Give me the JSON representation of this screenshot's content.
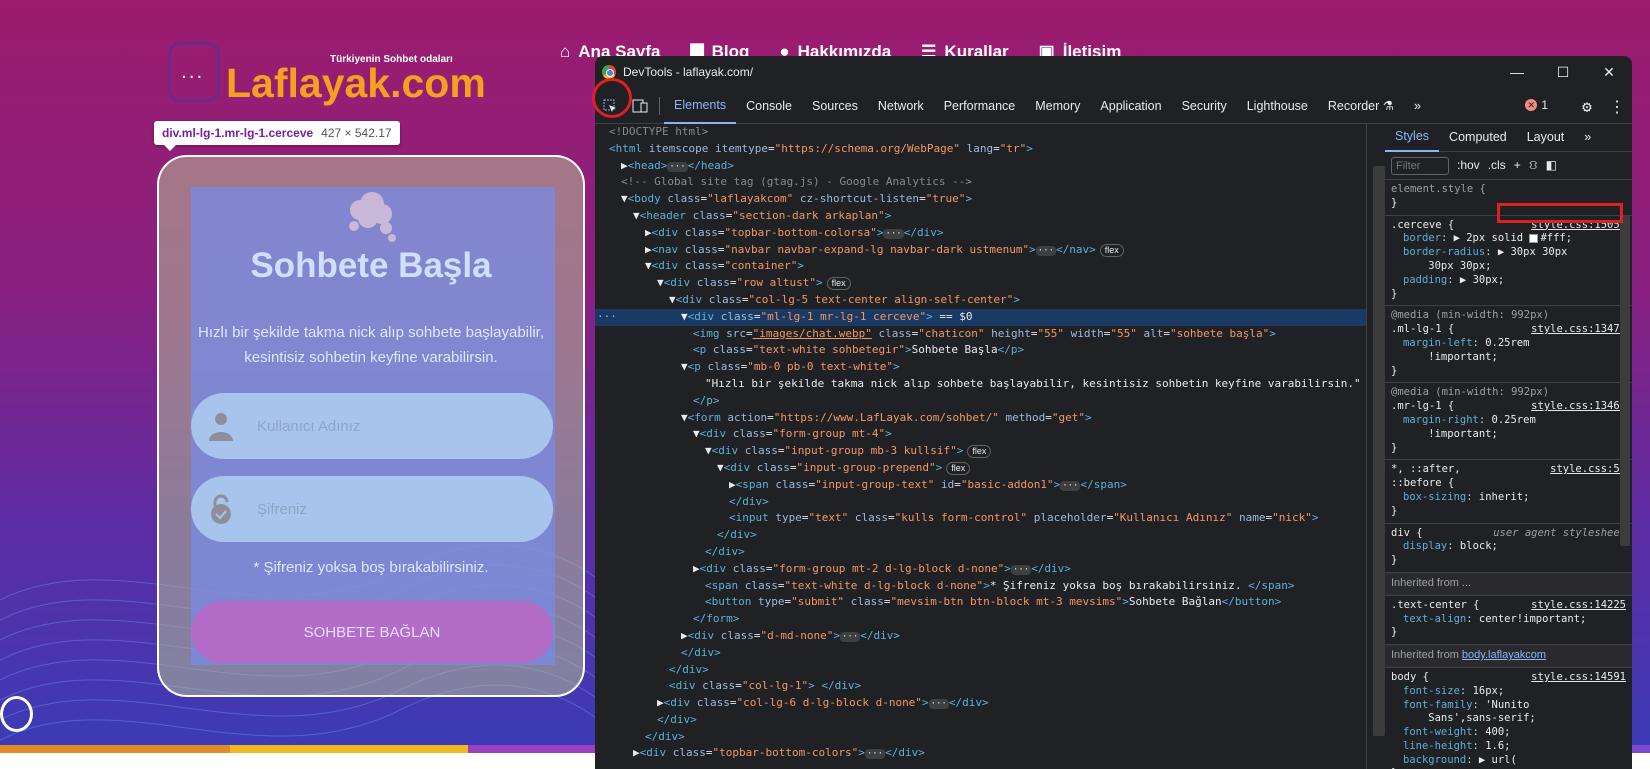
{
  "site": {
    "tagline": "Türkiyenin Sohbet odaları",
    "logo_text": "Laflayak.com",
    "nav": [
      "Ana Sayfa",
      "Blog",
      "Hakkımızda",
      "Kurallar",
      "İletişim"
    ],
    "card": {
      "title": "Sohbete Başla",
      "desc": "Hızlı bir şekilde takma nick alıp sohbete başlayabilir, kesintisiz sohbetin keyfine varabilirsin.",
      "username_placeholder": "Kullanıcı Adınız",
      "password_placeholder": "Şifreniz",
      "note": "* Şifreniz yoksa boş bırakabilirsiniz.",
      "button": "SOHBETE BAĞLAN"
    },
    "tooltip": {
      "selector": "div.ml-lg-1.mr-lg-1.cerceve",
      "size": "427 × 542.17"
    },
    "strip_colors": [
      "#e08a2a",
      "#f5b820",
      "#9c3fc0",
      "#7a4ad0"
    ]
  },
  "devtools": {
    "title": "DevTools - laflayak.com/",
    "tabs": [
      "Elements",
      "Console",
      "Sources",
      "Network",
      "Performance",
      "Memory",
      "Application",
      "Security",
      "Lighthouse",
      "Recorder"
    ],
    "active_tab": "Elements",
    "error_count": "1",
    "dom_lines": [
      {
        "i": 0,
        "h": "<span class='cmt'>&lt;!DOCTYPE html&gt;</span>"
      },
      {
        "i": 0,
        "h": "<span class='tag'>&lt;html</span> <span class='attr'>itemscope itemtype</span>=<span class='val'>\"https://schema.org/WebPage\"</span> <span class='attr'>lang</span>=<span class='val'>\"tr\"</span><span class='tag'>&gt;</span>"
      },
      {
        "i": 1,
        "h": "▶<span class='tag'>&lt;head&gt;</span><span class='dots'>···</span><span class='tag'>&lt;/head&gt;</span>"
      },
      {
        "i": 1,
        "h": "<span class='cmt'>&lt;!-- Global site tag (gtag.js) - Google Analytics --&gt;</span>"
      },
      {
        "i": 1,
        "h": "▼<span class='tag'>&lt;body</span> <span class='attr'>class</span>=<span class='val'>\"laflayakcom\"</span> <span class='attr'>cz-shortcut-listen</span>=<span class='val'>\"true\"</span><span class='tag'>&gt;</span>"
      },
      {
        "i": 2,
        "h": "▼<span class='tag'>&lt;header</span> <span class='attr'>class</span>=<span class='val'>\"section-dark arkaplan\"</span><span class='tag'>&gt;</span>"
      },
      {
        "i": 3,
        "h": "▶<span class='tag'>&lt;div</span> <span class='attr'>class</span>=<span class='val'>\"topbar-bottom-colorsa\"</span><span class='tag'>&gt;</span><span class='dots'>···</span><span class='tag'>&lt;/div&gt;</span>"
      },
      {
        "i": 3,
        "h": "▶<span class='tag'>&lt;nav</span> <span class='attr'>class</span>=<span class='val'>\"navbar navbar-expand-lg navbar-dark ustmenum\"</span><span class='tag'>&gt;</span><span class='dots'>···</span><span class='tag'>&lt;/nav&gt;</span><span class='flexb'>flex</span>"
      },
      {
        "i": 3,
        "h": "▼<span class='tag'>&lt;div</span> <span class='attr'>class</span>=<span class='val'>\"container\"</span><span class='tag'>&gt;</span>"
      },
      {
        "i": 4,
        "h": "▼<span class='tag'>&lt;div</span> <span class='attr'>class</span>=<span class='val'>\"row altust\"</span><span class='tag'>&gt;</span><span class='flexb'>flex</span>"
      },
      {
        "i": 5,
        "h": "▼<span class='tag'>&lt;div</span> <span class='attr'>class</span>=<span class='val'>\"col-lg-5 text-center align-self-center\"</span><span class='tag'>&gt;</span>"
      },
      {
        "i": 6,
        "h": "▼<span class='tag'>&lt;div</span> <span class='attr'>class</span>=<span class='val'>\"ml-lg-1 mr-lg-1 cerceve\"</span><span class='tag'>&gt;</span> == $0",
        "sel": true
      },
      {
        "i": 7,
        "h": "<span class='tag'>&lt;img</span> <span class='attr'>src</span>=<span class='link'>\"images/chat.webp\"</span> <span class='attr'>class</span>=<span class='val'>\"chaticon\"</span> <span class='attr'>height</span>=<span class='val'>\"55\"</span> <span class='attr'>width</span>=<span class='val'>\"55\"</span> <span class='attr'>alt</span>=<span class='val'>\"sohbete başla\"</span><span class='tag'>&gt;</span>"
      },
      {
        "i": 7,
        "h": "<span class='tag'>&lt;p</span> <span class='attr'>class</span>=<span class='val'>\"text-white sohbetegir\"</span><span class='tag'>&gt;</span>Sohbete Başla<span class='tag'>&lt;/p&gt;</span>"
      },
      {
        "i": 6,
        "h": "▼<span class='tag'>&lt;p</span> <span class='attr'>class</span>=<span class='val'>\"mb-0 pb-0 text-white\"</span><span class='tag'>&gt;</span>"
      },
      {
        "i": 8,
        "h": "\"Hızlı bir şekilde takma nick alıp sohbete başlayabilir, kesintisiz sohbetin keyfine varabilirsin.\""
      },
      {
        "i": 7,
        "h": "<span class='tag'>&lt;/p&gt;</span>"
      },
      {
        "i": 6,
        "h": "▼<span class='tag'>&lt;form</span> <span class='attr'>action</span>=<span class='val'>\"https://www.LafLayak.com/sohbet/\"</span> <span class='attr'>method</span>=<span class='val'>\"get\"</span><span class='tag'>&gt;</span>"
      },
      {
        "i": 7,
        "h": "▼<span class='tag'>&lt;div</span> <span class='attr'>class</span>=<span class='val'>\"form-group mt-4\"</span><span class='tag'>&gt;</span>"
      },
      {
        "i": 8,
        "h": "▼<span class='tag'>&lt;div</span> <span class='attr'>class</span>=<span class='val'>\"input-group mb-3 kullsif\"</span><span class='tag'>&gt;</span><span class='flexb'>flex</span>"
      },
      {
        "i": 9,
        "h": "▼<span class='tag'>&lt;div</span> <span class='attr'>class</span>=<span class='val'>\"input-group-prepend\"</span><span class='tag'>&gt;</span><span class='flexb'>flex</span>"
      },
      {
        "i": 10,
        "h": "▶<span class='tag'>&lt;span</span> <span class='attr'>class</span>=<span class='val'>\"input-group-text\"</span> <span class='attr'>id</span>=<span class='val'>\"basic-addon1\"</span><span class='tag'>&gt;</span><span class='dots'>···</span><span class='tag'>&lt;/span&gt;</span>"
      },
      {
        "i": 10,
        "h": "<span class='tag'>&lt;/div&gt;</span>"
      },
      {
        "i": 10,
        "h": "<span class='tag'>&lt;input</span> <span class='attr'>type</span>=<span class='val'>\"text\"</span> <span class='attr'>class</span>=<span class='val'>\"kulls form-control\"</span> <span class='attr'>placeholder</span>=<span class='val'>\"Kullanıcı Adınız\"</span> <span class='attr'>name</span>=<span class='val'>\"nick\"</span><span class='tag'>&gt;</span>"
      },
      {
        "i": 9,
        "h": "<span class='tag'>&lt;/div&gt;</span>"
      },
      {
        "i": 8,
        "h": "<span class='tag'>&lt;/div&gt;</span>"
      },
      {
        "i": 7,
        "h": "▶<span class='tag'>&lt;div</span> <span class='attr'>class</span>=<span class='val'>\"form-group mt-2 d-lg-block d-none\"</span><span class='tag'>&gt;</span><span class='dots'>···</span><span class='tag'>&lt;/div&gt;</span>"
      },
      {
        "i": 8,
        "h": "<span class='tag'>&lt;span</span> <span class='attr'>class</span>=<span class='val'>\"text-white d-lg-block d-none\"</span><span class='tag'>&gt;</span>* Şifreniz yoksa boş bırakabilirsiniz. <span class='tag'>&lt;/span&gt;</span>"
      },
      {
        "i": 8,
        "h": "<span class='tag'>&lt;button</span> <span class='attr'>type</span>=<span class='val'>\"submit\"</span> <span class='attr'>class</span>=<span class='val'>\"mevsim-btn btn-block mt-3 mevsims\"</span><span class='tag'>&gt;</span>Sohbete Bağlan<span class='tag'>&lt;/button&gt;</span>"
      },
      {
        "i": 7,
        "h": "<span class='tag'>&lt;/form&gt;</span>"
      },
      {
        "i": 6,
        "h": "▶<span class='tag'>&lt;div</span> <span class='attr'>class</span>=<span class='val'>\"d-md-none\"</span><span class='tag'>&gt;</span><span class='dots'>···</span><span class='tag'>&lt;/div&gt;</span>"
      },
      {
        "i": 6,
        "h": "<span class='tag'>&lt;/div&gt;</span>"
      },
      {
        "i": 5,
        "h": "<span class='tag'>&lt;/div&gt;</span>"
      },
      {
        "i": 5,
        "h": "<span class='tag'>&lt;div</span> <span class='attr'>class</span>=<span class='val'>\"col-lg-1\"</span><span class='tag'>&gt;</span> <span class='tag'>&lt;/div&gt;</span>"
      },
      {
        "i": 4,
        "h": "▶<span class='tag'>&lt;div</span> <span class='attr'>class</span>=<span class='val'>\"col-lg-6 d-lg-block d-none\"</span><span class='tag'>&gt;</span><span class='dots'>···</span><span class='tag'>&lt;/div&gt;</span>"
      },
      {
        "i": 4,
        "h": "<span class='tag'>&lt;/div&gt;</span>"
      },
      {
        "i": 3,
        "h": "<span class='tag'>&lt;/div&gt;</span>"
      },
      {
        "i": 2,
        "h": "▶<span class='tag'>&lt;div</span> <span class='attr'>class</span>=<span class='val'>\"topbar-bottom-colors\"</span><span class='tag'>&gt;</span><span class='dots'>···</span><span class='tag'>&lt;/div&gt;</span>"
      }
    ],
    "styles": {
      "tabs": [
        "Styles",
        "Computed",
        "Layout"
      ],
      "filter_placeholder": "Filter",
      "hov": ":hov",
      "cls": ".cls",
      "element_style": "element.style {",
      "rules": [
        {
          "selector": ".cerceve {",
          "source": "style.css:15050",
          "props": [
            "border: ▶ 2px solid □#fff;",
            "border-radius: ▶ 30px 30px",
            "    30px 30px;",
            "padding: ▶ 30px;"
          ]
        },
        {
          "media": "@media (min-width: 992px)",
          "selector": ".ml-lg-1 {",
          "source": "style.css:13474",
          "props": [
            "margin-left: 0.25rem",
            "    !important;"
          ]
        },
        {
          "media": "@media (min-width: 992px)",
          "selector": ".mr-lg-1 {",
          "source": "style.css:13466",
          "props": [
            "margin-right: 0.25rem",
            "    !important;"
          ]
        },
        {
          "selector": "*, ::after,",
          "selector2": "::before {",
          "source": "style.css:55",
          "props": [
            "box-sizing: inherit;"
          ]
        },
        {
          "selector": "div {",
          "source": "user agent stylesheet",
          "ua": true,
          "props": [
            "display: block;"
          ]
        }
      ],
      "inherited1": "Inherited from ...",
      "rule_tc": {
        "selector": ".text-center {",
        "source": "style.css:14225",
        "props": [
          "text-align: center!important;"
        ]
      },
      "inherited2_prefix": "Inherited from ",
      "inherited2_link": "body.laflayakcom",
      "rule_body": {
        "selector": "body {",
        "source": "style.css:14591",
        "props": [
          "font-size: 16px;",
          "font-family: 'Nunito",
          "    Sans',sans-serif;",
          "font-weight: 400;",
          "line-height: 1.6;",
          "background: ▶ url("
        ]
      }
    }
  }
}
